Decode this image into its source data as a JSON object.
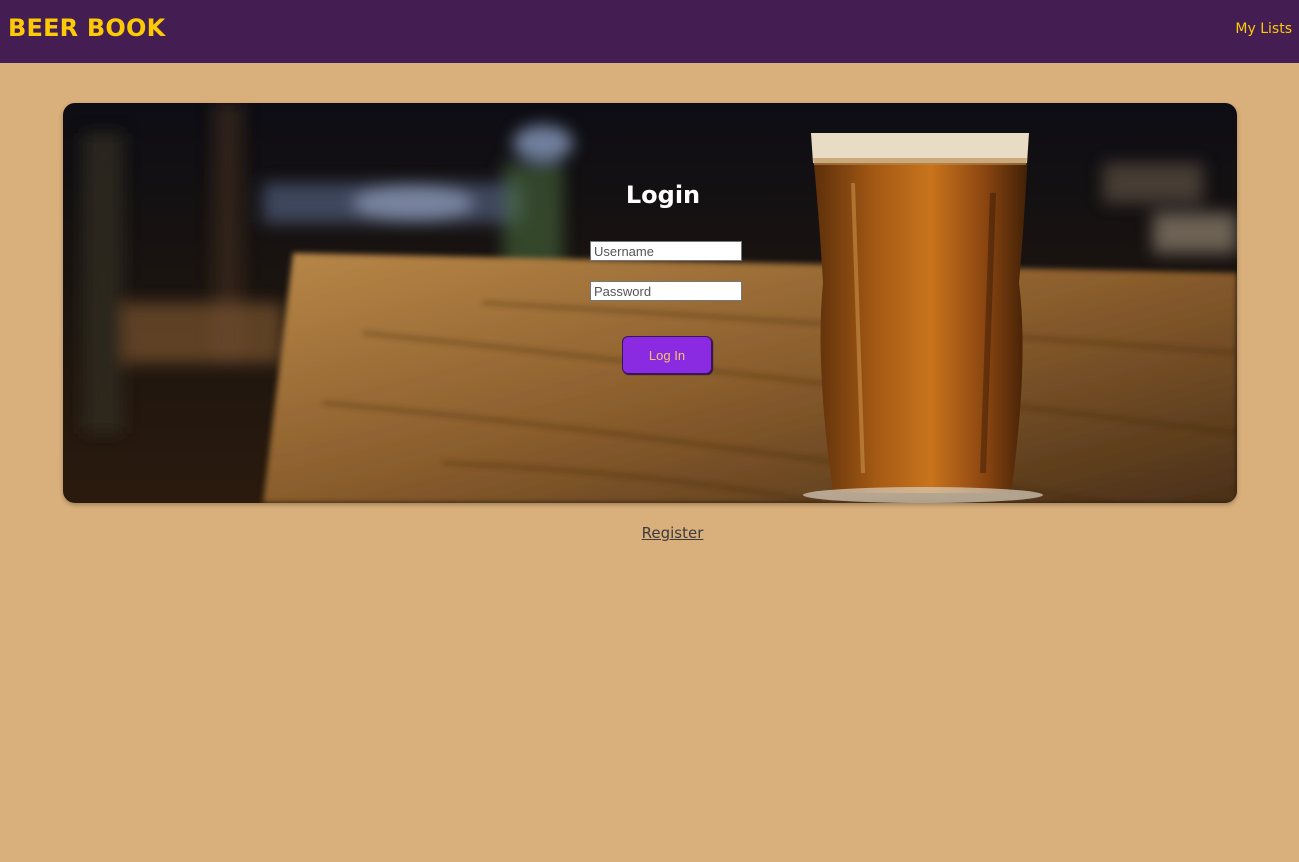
{
  "navbar": {
    "brand": "BEER BOOK",
    "links": [
      {
        "label": "My Lists"
      }
    ]
  },
  "login": {
    "title": "Login",
    "username": {
      "value": "",
      "placeholder": "Username"
    },
    "password": {
      "value": "",
      "placeholder": "Password"
    },
    "submit_label": "Log In"
  },
  "register_label": "Register",
  "colors": {
    "navbar_bg": "#441d52",
    "brand": "#fccb06",
    "page_bg": "#d9af7b",
    "button": "#8a2be2"
  }
}
